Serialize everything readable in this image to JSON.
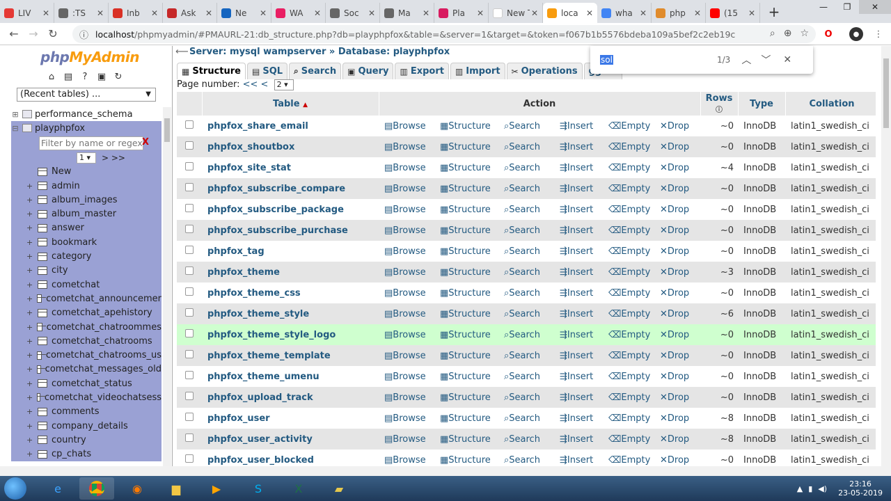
{
  "browser": {
    "tabs": [
      {
        "label": "LIV",
        "color": "#e53935"
      },
      {
        "label": ":TS",
        "color": "#666666"
      },
      {
        "label": "Inb",
        "color": "#d93025"
      },
      {
        "label": "Ask",
        "color": "#c62828"
      },
      {
        "label": "Ne",
        "color": "#1565c0"
      },
      {
        "label": "WA",
        "color": "#e91e63"
      },
      {
        "label": "Soc",
        "color": "#666666"
      },
      {
        "label": "Ma",
        "color": "#666666"
      },
      {
        "label": "Pla",
        "color": "#d81b60"
      },
      {
        "label": "New Ta",
        "color": "#ffffff"
      },
      {
        "label": "loca",
        "color": "#f89c0e",
        "active": true
      },
      {
        "label": "wha",
        "color": "#4285f4"
      },
      {
        "label": "php",
        "color": "#e08b2c"
      },
      {
        "label": "(15",
        "color": "#ff0000"
      }
    ],
    "url_host": "localhost",
    "url_path": "/phpmyadmin/#PMAURL-21:db_structure.php?db=playphpfox&table=&server=1&target=&token=f067b1b5576bdeba109a5bef2c2eb19c"
  },
  "find_bar": {
    "query": "sol",
    "count": "1/3"
  },
  "left": {
    "logo_php": "php",
    "logo_myadmin": "MyAdmin",
    "recent_tables": "(Recent tables) ...",
    "tree_items": [
      "performance_schema",
      "playphpfox"
    ],
    "filter_placeholder": "Filter by name or regex",
    "filter_clear": "X",
    "page_select": "1",
    "page_next": "> >>",
    "new_label": "New",
    "tables": [
      "admin",
      "album_images",
      "album_master",
      "answer",
      "bookmark",
      "category",
      "city",
      "cometchat",
      "cometchat_announcemer",
      "cometchat_apehistory",
      "cometchat_chatroommes",
      "cometchat_chatrooms",
      "cometchat_chatrooms_us",
      "cometchat_messages_old",
      "cometchat_status",
      "cometchat_videochatsess",
      "comments",
      "company_details",
      "country",
      "cp_chats"
    ]
  },
  "right": {
    "breadcrumb_server": "Server: mysql wampserver",
    "breadcrumb_db": "Database: playphpfox",
    "menu": [
      {
        "label": "Structure",
        "icon": "▦",
        "active": true
      },
      {
        "label": "SQL",
        "icon": "▤"
      },
      {
        "label": "Search",
        "icon": "⌕"
      },
      {
        "label": "Query",
        "icon": "▣"
      },
      {
        "label": "Export",
        "icon": "▥"
      },
      {
        "label": "Import",
        "icon": "▥"
      },
      {
        "label": "Operations",
        "icon": "✂"
      },
      {
        "label": "ggers",
        "icon": ""
      }
    ],
    "page_number_label": "Page number:",
    "page_prev": "<< <",
    "page_value": "2",
    "headers": {
      "table": "Table",
      "action": "Action",
      "rows": "Rows",
      "type": "Type",
      "collation": "Collation"
    },
    "actions": [
      "Browse",
      "Structure",
      "Search",
      "Insert",
      "Empty",
      "Drop"
    ],
    "rows": [
      {
        "name": "phpfox_share_email",
        "rows": "~0",
        "type": "InnoDB",
        "coll": "latin1_swedish_ci"
      },
      {
        "name": "phpfox_shoutbox",
        "rows": "~0",
        "type": "InnoDB",
        "coll": "latin1_swedish_ci"
      },
      {
        "name": "phpfox_site_stat",
        "rows": "~4",
        "type": "InnoDB",
        "coll": "latin1_swedish_ci"
      },
      {
        "name": "phpfox_subscribe_compare",
        "rows": "~0",
        "type": "InnoDB",
        "coll": "latin1_swedish_ci"
      },
      {
        "name": "phpfox_subscribe_package",
        "rows": "~0",
        "type": "InnoDB",
        "coll": "latin1_swedish_ci"
      },
      {
        "name": "phpfox_subscribe_purchase",
        "rows": "~0",
        "type": "InnoDB",
        "coll": "latin1_swedish_ci"
      },
      {
        "name": "phpfox_tag",
        "rows": "~0",
        "type": "InnoDB",
        "coll": "latin1_swedish_ci"
      },
      {
        "name": "phpfox_theme",
        "rows": "~3",
        "type": "InnoDB",
        "coll": "latin1_swedish_ci"
      },
      {
        "name": "phpfox_theme_css",
        "rows": "~0",
        "type": "InnoDB",
        "coll": "latin1_swedish_ci"
      },
      {
        "name": "phpfox_theme_style",
        "rows": "~6",
        "type": "InnoDB",
        "coll": "latin1_swedish_ci"
      },
      {
        "name": "phpfox_theme_style_logo",
        "rows": "~0",
        "type": "InnoDB",
        "coll": "latin1_swedish_ci",
        "hl": true
      },
      {
        "name": "phpfox_theme_template",
        "rows": "~0",
        "type": "InnoDB",
        "coll": "latin1_swedish_ci"
      },
      {
        "name": "phpfox_theme_umenu",
        "rows": "~0",
        "type": "InnoDB",
        "coll": "latin1_swedish_ci"
      },
      {
        "name": "phpfox_upload_track",
        "rows": "~0",
        "type": "InnoDB",
        "coll": "latin1_swedish_ci"
      },
      {
        "name": "phpfox_user",
        "rows": "~8",
        "type": "InnoDB",
        "coll": "latin1_swedish_ci"
      },
      {
        "name": "phpfox_user_activity",
        "rows": "~8",
        "type": "InnoDB",
        "coll": "latin1_swedish_ci"
      },
      {
        "name": "phpfox_user_blocked",
        "rows": "~0",
        "type": "InnoDB",
        "coll": "latin1_swedish_ci"
      }
    ]
  },
  "taskbar": {
    "time": "23:16",
    "date": "23-05-2019"
  }
}
